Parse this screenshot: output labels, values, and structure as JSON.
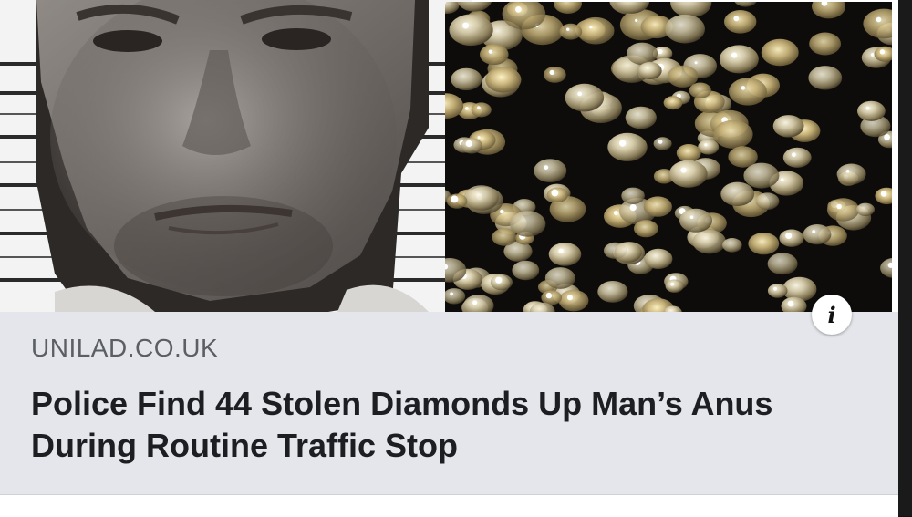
{
  "post": {
    "domain": "UNILAD.CO.UK",
    "headline": "Police Find 44 Stolen Diamonds Up Man’s Anus During Routine Traffic Stop"
  },
  "images": {
    "left_icon": "mugshot-photo",
    "right_icon": "diamonds-photo"
  },
  "info_button": {
    "glyph": "i",
    "icon": "info-icon"
  },
  "colors": {
    "card_background": "#e4e6eb",
    "domain_text": "#5b5e63",
    "headline_text": "#1c1e21"
  }
}
